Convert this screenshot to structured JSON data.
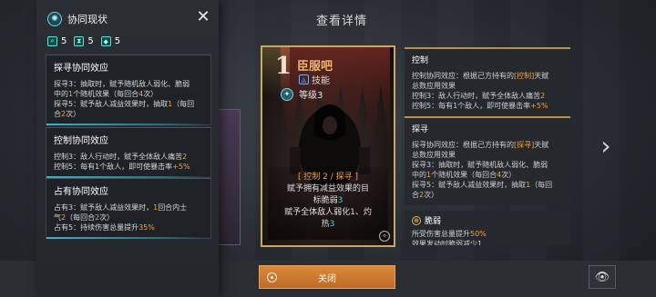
{
  "header": {
    "title": "查看详情"
  },
  "left_panel": {
    "title": "协同现状",
    "counts": [
      {
        "icon": "magnifier-icon",
        "value": "5"
      },
      {
        "icon": "hourglass-icon",
        "value": "5"
      },
      {
        "icon": "gem-icon",
        "value": "5"
      }
    ],
    "effects": [
      {
        "title": "探寻协同效应",
        "lines": [
          [
            "探寻3：抽取时，赋予随机敌人弱化、脆弱"
          ],
          [
            "中的",
            {
              "t": "1",
              "c": "o"
            },
            "个随机效果（每回合",
            {
              "t": "4",
              "c": "o"
            },
            "次）"
          ],
          [
            "探寻5：赋予敌人减益效果时，抽取",
            {
              "t": "1",
              "c": "o"
            },
            "（每回"
          ],
          [
            "合",
            {
              "t": "2",
              "c": "o"
            },
            "次）"
          ]
        ]
      },
      {
        "title": "控制协同效应",
        "lines": [
          [
            "控制3：敌人行动时，赋予全体敌人痛苦",
            {
              "t": "2",
              "c": "o"
            }
          ],
          [
            "控制5：每有1个敌人，即可使暴击率",
            {
              "t": "+5%",
              "c": "o"
            }
          ]
        ]
      },
      {
        "title": "占有协同效应",
        "lines": [
          [
            "占有3：赋予敌人减益效果时，",
            {
              "t": "1",
              "c": "o"
            },
            "回合内士"
          ],
          [
            "气",
            {
              "t": "2",
              "c": "o"
            },
            "（每回合",
            {
              "t": "2",
              "c": "o"
            },
            "次）"
          ],
          [
            "占有5：持续伤害总量提升",
            {
              "t": "35%",
              "c": "o"
            }
          ]
        ]
      }
    ]
  },
  "card": {
    "cost": "1",
    "name": "臣服吧",
    "type": "技能",
    "level": "等级3",
    "tags": "[ 控制 2 / 探寻 ]",
    "desc_lines": [
      [
        "赋予拥有减益效果的目"
      ],
      [
        "标脆弱",
        {
          "t": "3",
          "c": "c"
        }
      ],
      [
        "赋予全体敌人弱化1、灼"
      ],
      [
        "热",
        {
          "t": "3",
          "c": "c"
        }
      ]
    ]
  },
  "details": [
    {
      "title": "控制",
      "lines": [
        [
          "控制协同效应：根据己方持有的",
          {
            "t": "[控制]",
            "c": "o"
          },
          "天赋"
        ],
        [
          "总数应用效果"
        ],
        [
          "控制3：敌人行动时，赋予全体敌人痛苦",
          {
            "t": "2",
            "c": "o"
          }
        ],
        [
          "控制5：每有1个敌人，即可使暴击率",
          {
            "t": "+5%",
            "c": "o"
          }
        ]
      ]
    },
    {
      "title": "探寻",
      "lines": [
        [
          "探寻协同效应：根据己方持有的",
          {
            "t": "[探寻]",
            "c": "o"
          },
          "天赋"
        ],
        [
          "总数应用效果"
        ],
        [
          "探寻3：抽取时，赋予随机敌人弱化、脆弱"
        ],
        [
          "中的",
          {
            "t": "1",
            "c": "o"
          },
          "个随机效果（每回合",
          {
            "t": "4",
            "c": "o"
          },
          "次）"
        ],
        [
          "探寻5：赋予敌人减益效果时，抽取",
          {
            "t": "1",
            "c": "o"
          },
          "（每回"
        ],
        [
          "合",
          {
            "t": "2",
            "c": "o"
          },
          "次）"
        ]
      ]
    }
  ],
  "debuff": {
    "title": "脆弱",
    "lines": [
      [
        "所受伤害总量提升",
        {
          "t": "50%",
          "c": "o"
        }
      ],
      [
        "效果发动时脆弱减少1"
      ]
    ]
  },
  "buttons": {
    "close": "关闭"
  },
  "icons": {
    "panel_icon": "synergy-icon",
    "close": "close-x-icon",
    "next": "chevron-right-icon",
    "eye": "eye-icon",
    "type": "skill-type-icon",
    "level": "level-icon"
  },
  "colors": {
    "accent_orange": "#f2a24a",
    "accent_cyan": "#4fd2dc",
    "button": "#c97430"
  }
}
